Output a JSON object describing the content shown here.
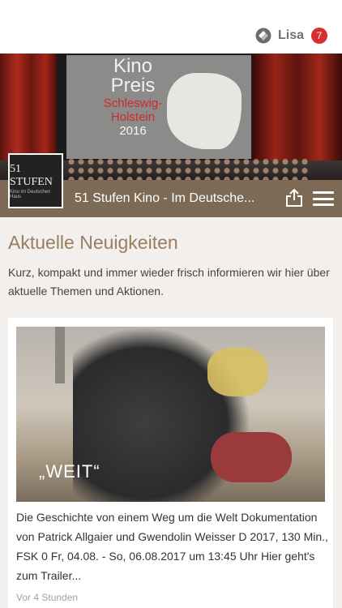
{
  "user": {
    "name": "Lisa",
    "notification_count": "7",
    "icon": "app-logo-icon"
  },
  "hero": {
    "screen_line1": "Kino",
    "screen_line2": "Preis",
    "screen_line3": "Schleswig-",
    "screen_line4": "Holstein",
    "screen_year": "2016"
  },
  "header": {
    "logo_main": "51 STUFEN",
    "logo_sub": "Kino im Deutschen Haus",
    "title": "51 Stufen Kino - Im Deutsche...",
    "share_icon": "share-icon",
    "menu_icon": "hamburger-menu-icon"
  },
  "section": {
    "title": "Aktuelle Neuigkeiten",
    "intro": "Kurz, kompakt und immer wieder frisch informieren wir hier über aktuelle Themen und Aktionen."
  },
  "news": [
    {
      "image_caption": "„WEIT“",
      "description": "Die Geschichte von einem Weg um die Welt Dokumentation von Patrick Allgaier und Gwendolin Weisser D 2017, 130 Min., FSK 0 Fr, 04.08. - So, 06.08.2017 um 13:45 Uhr Hier geht's zum Trailer...",
      "time": "Vor 4 Stunden"
    }
  ],
  "colors": {
    "accent": "#9a7e62",
    "titlebar": "#7c6a55",
    "badge": "#d62f2f",
    "background": "#f2efec"
  }
}
